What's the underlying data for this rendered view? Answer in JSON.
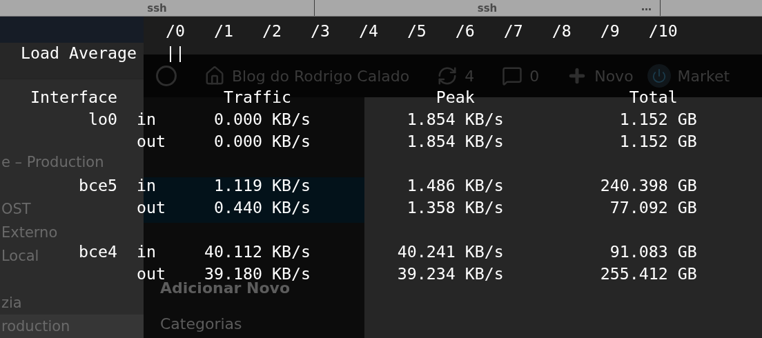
{
  "tabs": [
    {
      "title": "ssh"
    },
    {
      "title": "ssh",
      "more": "…"
    }
  ],
  "background": {
    "sidebar_groups": [
      [
        {
          "label": "e – Production",
          "selected": false
        }
      ],
      [
        {
          "label": "OST",
          "selected": false
        },
        {
          "label": "Externo",
          "selected": false
        },
        {
          "label": "Local",
          "selected": false
        }
      ],
      [
        {
          "label": "zia",
          "selected": false
        },
        {
          "label": "roduction",
          "selected": true
        }
      ]
    ],
    "admin_bar": {
      "site_title": "Blog do Rodrigo Calado",
      "updates": "4",
      "comments": "0",
      "new": "Novo",
      "plugin": "Market"
    },
    "wp_menu": [
      "Adicionar Novo",
      "Categorias"
    ]
  },
  "scale": [
    "/0",
    "/1",
    "/2",
    "/3",
    "/4",
    "/5",
    "/6",
    "/7",
    "/8",
    "/9",
    "/10"
  ],
  "load_average": {
    "label": "Load Average",
    "bar": "||"
  },
  "columns": [
    "Interface",
    "Traffic",
    "Peak",
    "Total"
  ],
  "interfaces": [
    {
      "name": "lo0",
      "rows": [
        {
          "direction": "in",
          "traffic": "0.000 KB/s",
          "peak": "1.854 KB/s",
          "total": "1.152 GB"
        },
        {
          "direction": "out",
          "traffic": "0.000 KB/s",
          "peak": "1.854 KB/s",
          "total": "1.152 GB"
        }
      ]
    },
    {
      "name": "bce5",
      "rows": [
        {
          "direction": "in",
          "traffic": "1.119 KB/s",
          "peak": "1.486 KB/s",
          "total": "240.398 GB"
        },
        {
          "direction": "out",
          "traffic": "0.440 KB/s",
          "peak": "1.358 KB/s",
          "total": "77.092 GB"
        }
      ]
    },
    {
      "name": "bce4",
      "rows": [
        {
          "direction": "in",
          "traffic": "40.112 KB/s",
          "peak": "40.241 KB/s",
          "total": "91.083 GB"
        },
        {
          "direction": "out",
          "traffic": "39.180 KB/s",
          "peak": "39.234 KB/s",
          "total": "255.412 GB"
        }
      ]
    }
  ]
}
